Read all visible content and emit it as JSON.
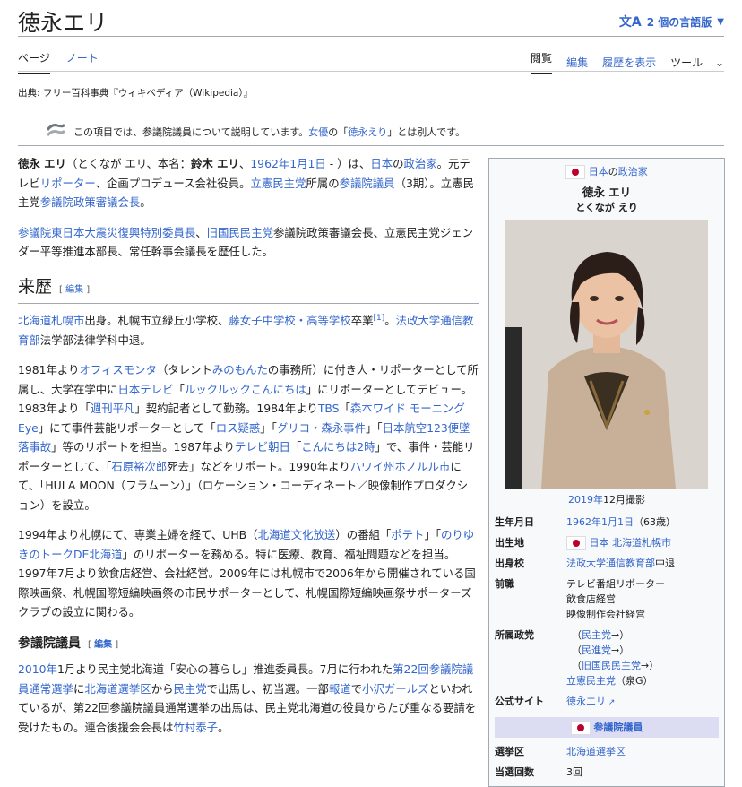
{
  "page": {
    "title": "徳永エリ",
    "languages": "2 個の言語版",
    "tabs_left": [
      "ページ",
      "ノート"
    ],
    "tabs_right": [
      "閲覧",
      "編集",
      "履歴を表示",
      "ツール"
    ],
    "source": "出典: フリー百科事典『ウィキペディア（Wikipedia）』",
    "hatnote": {
      "pre": "この項目では、参議院議員について説明しています。",
      "link1": "女優",
      "mid": "の「",
      "link2": "徳永えり",
      "post": "」とは別人です。"
    }
  },
  "body": {
    "edit": "編集",
    "h_career": "来歴",
    "h_councillor": "参議院議員",
    "p1": {
      "name_bold": "徳永 エリ",
      "kana": "（とくなが エリ、本名：",
      "real_bold": "鈴木 エリ",
      "dob": "1962年1月1日",
      "t1": " - ）は、",
      "jp": "日本",
      "t2": "の",
      "pol": "政治家",
      "t3": "。元テレビ",
      "rep": "リポーター",
      "t4": "、企画プロデュース会社役員。",
      "cdp": "立憲民主党",
      "t5": "所属の",
      "hc": "参議院議員",
      "t6": "（3期）。立憲民主党",
      "hcpol": "参議院政策審議会長",
      "t7": "。"
    },
    "p2": {
      "l1": "参議院東日本大震災復興特別委員長",
      "t1": "、",
      "l2": "旧国民民主党",
      "t2": "参議院政策審議会長、立憲民主党ジェンダー平等推進本部長、常任幹事会議長を歴任した。"
    },
    "p3": {
      "l1": "北海道札幌市",
      "t1": "出身。札幌市立緑丘小学校、",
      "l2": "藤女子中学校・高等学校",
      "t2": "卒業",
      "ref": "[1]",
      "t3": "。",
      "l3": "法政大学通信教育部",
      "t4": "法学部法律学科中退。"
    },
    "p4": {
      "t1": "1981年より",
      "l1": "オフィスモンタ",
      "t2": "（タレント",
      "l2": "みのもんた",
      "t3": "の事務所）に付き人・リポーターとして所属し、大学在学中に",
      "l3": "日本テレビ",
      "t4": "「",
      "l4": "ルックルックこんにちは",
      "t5": "」にリポーターとしてデビュー。1983年より「",
      "l5": "週刊平凡",
      "t6": "」契約記者として勤務。1984年より",
      "l6": "TBS",
      "t7": "「",
      "l7": "森本ワイド モーニングEye",
      "t8": "」にて事件芸能リポーターとして「",
      "l8": "ロス疑惑",
      "t9": "」「",
      "l9": "グリコ・森永事件",
      "t10": "」「",
      "l10": "日本航空123便墜落事故",
      "t11": "」等のリポートを担当。1987年より",
      "l11": "テレビ朝日",
      "t12": "「",
      "l12": "こんにちは2時",
      "t13": "」で、事件・芸能リポーターとして、「",
      "l13": "石原裕次郎",
      "t14": "死去」などをリポート。1990年より",
      "l14": "ハワイ州ホノルル市",
      "t15": "にて、「HULA MOON（フラムーン）」（ロケーション・コーディネート／映像制作プロダクション）を設立。"
    },
    "p5": {
      "t1": "1994年より札幌にて、専業主婦を経て、UHB（",
      "l1": "北海道文化放送",
      "t2": "）の番組「",
      "l2": "ポテト",
      "t3": "」「",
      "l3": "のりゆきのトークDE北海道",
      "t4": "」のリポーターを務める。特に医療、教育、福祉問題などを担当。1997年7月より飲食店経営、会社経営。2009年には札幌市で2006年から開催されている国際映画祭、札幌国際短編映画祭の市民サポーターとして、札幌国際短編映画祭サポーターズクラブの設立に関わる。"
    },
    "p6": {
      "l1": "2010年",
      "t1": "1月より民主党北海道「安心の暮らし」推進委員長。7月に行われた",
      "l2": "第22回参議院議員通常選挙",
      "t2": "に",
      "l3": "北海道選挙区",
      "t3": "から",
      "l4": "民主党",
      "t4": "で出馬し、初当選。一部",
      "l5": "報道",
      "t5": "で",
      "l6": "小沢ガールズ",
      "t6": "といわれているが、第22回参議院議員通常選挙の出馬は、民主党北海道の役員からたび重なる要請を受けたもの。連合後援会会長は",
      "l7": "竹村泰子",
      "t7": "。"
    }
  },
  "infobox": {
    "country": "日本",
    "country_suffix": "の",
    "role": "政治家",
    "name": "徳永 エリ",
    "kana": "とくなが えり",
    "caption_year": "2019年",
    "caption_rest": "12月撮影",
    "birth_label": "生年月日",
    "birth_link": "1962年1月1日",
    "birth_age": "（63歳）",
    "place_label": "出生地",
    "place_link": "日本 北海道札幌市",
    "school_label": "出身校",
    "school_link": "法政大学通信教育部",
    "school_suffix": "中退",
    "prev_label": "前職",
    "prev_lines": [
      "テレビ番組リポーター",
      "飲食店経営",
      "映像制作会社経営"
    ],
    "party_label": "所属政党",
    "parties": [
      {
        "open": "（",
        "link": "民主党",
        "close": "→）"
      },
      {
        "open": "（",
        "link": "民進党",
        "close": "→）"
      },
      {
        "open": "（",
        "link": "旧国民民主党",
        "close": "→）"
      },
      {
        "open": "",
        "link": "立憲民主党",
        "close": "（泉G）"
      }
    ],
    "site_label": "公式サイト",
    "site_link": "徳永エリ",
    "office_bar": "参議院議員",
    "district_label": "選挙区",
    "district_link": "北海道選挙区",
    "wins_label": "当選回数",
    "wins_value": "3回"
  }
}
